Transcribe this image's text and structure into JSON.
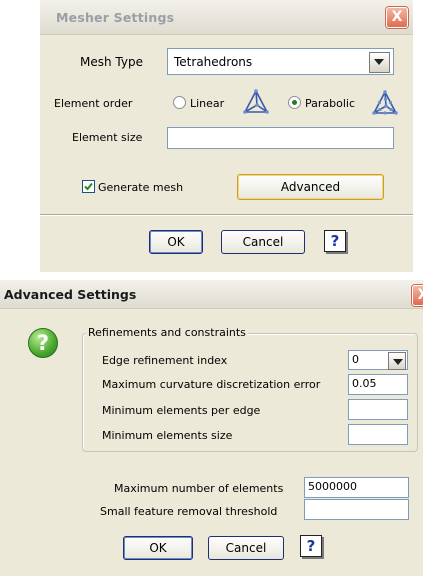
{
  "mesher": {
    "title": "Mesher Settings",
    "close_label": "X",
    "mesh_type_label": "Mesh Type",
    "mesh_type_value": "Tetrahedrons",
    "element_order_label": "Element order",
    "linear_label": "Linear",
    "parabolic_label": "Parabolic",
    "element_order_selected": "Parabolic",
    "element_size_label": "Element size",
    "element_size_value": "",
    "generate_mesh_label": "Generate mesh",
    "generate_mesh_checked": true,
    "advanced_button": "Advanced",
    "ok_button": "OK",
    "cancel_button": "Cancel",
    "help_label": "?"
  },
  "advanced": {
    "title": "Advanced Settings",
    "close_label": "X",
    "icon_name": "question-icon",
    "icon_glyph": "?",
    "group_title": "Refinements and constraints",
    "edge_refinement_label": "Edge refinement index",
    "edge_refinement_value": "0",
    "max_curvature_label": "Maximum curvature discretization error",
    "max_curvature_value": "0.05",
    "min_elements_per_edge_label": "Minimum elements per edge",
    "min_elements_per_edge_value": "",
    "min_elements_size_label": "Minimum elements size",
    "min_elements_size_value": "",
    "max_elements_label": "Maximum number of elements",
    "max_elements_value": "5000000",
    "small_feature_label": "Small feature removal threshold",
    "small_feature_value": "",
    "ok_button": "OK",
    "cancel_button": "Cancel",
    "help_label": "?"
  },
  "colors": {
    "dialog_bg": "#ece9d8",
    "field_border": "#7f9db9",
    "close_button": "#e06c4e",
    "accent_green": "#48a82e"
  }
}
